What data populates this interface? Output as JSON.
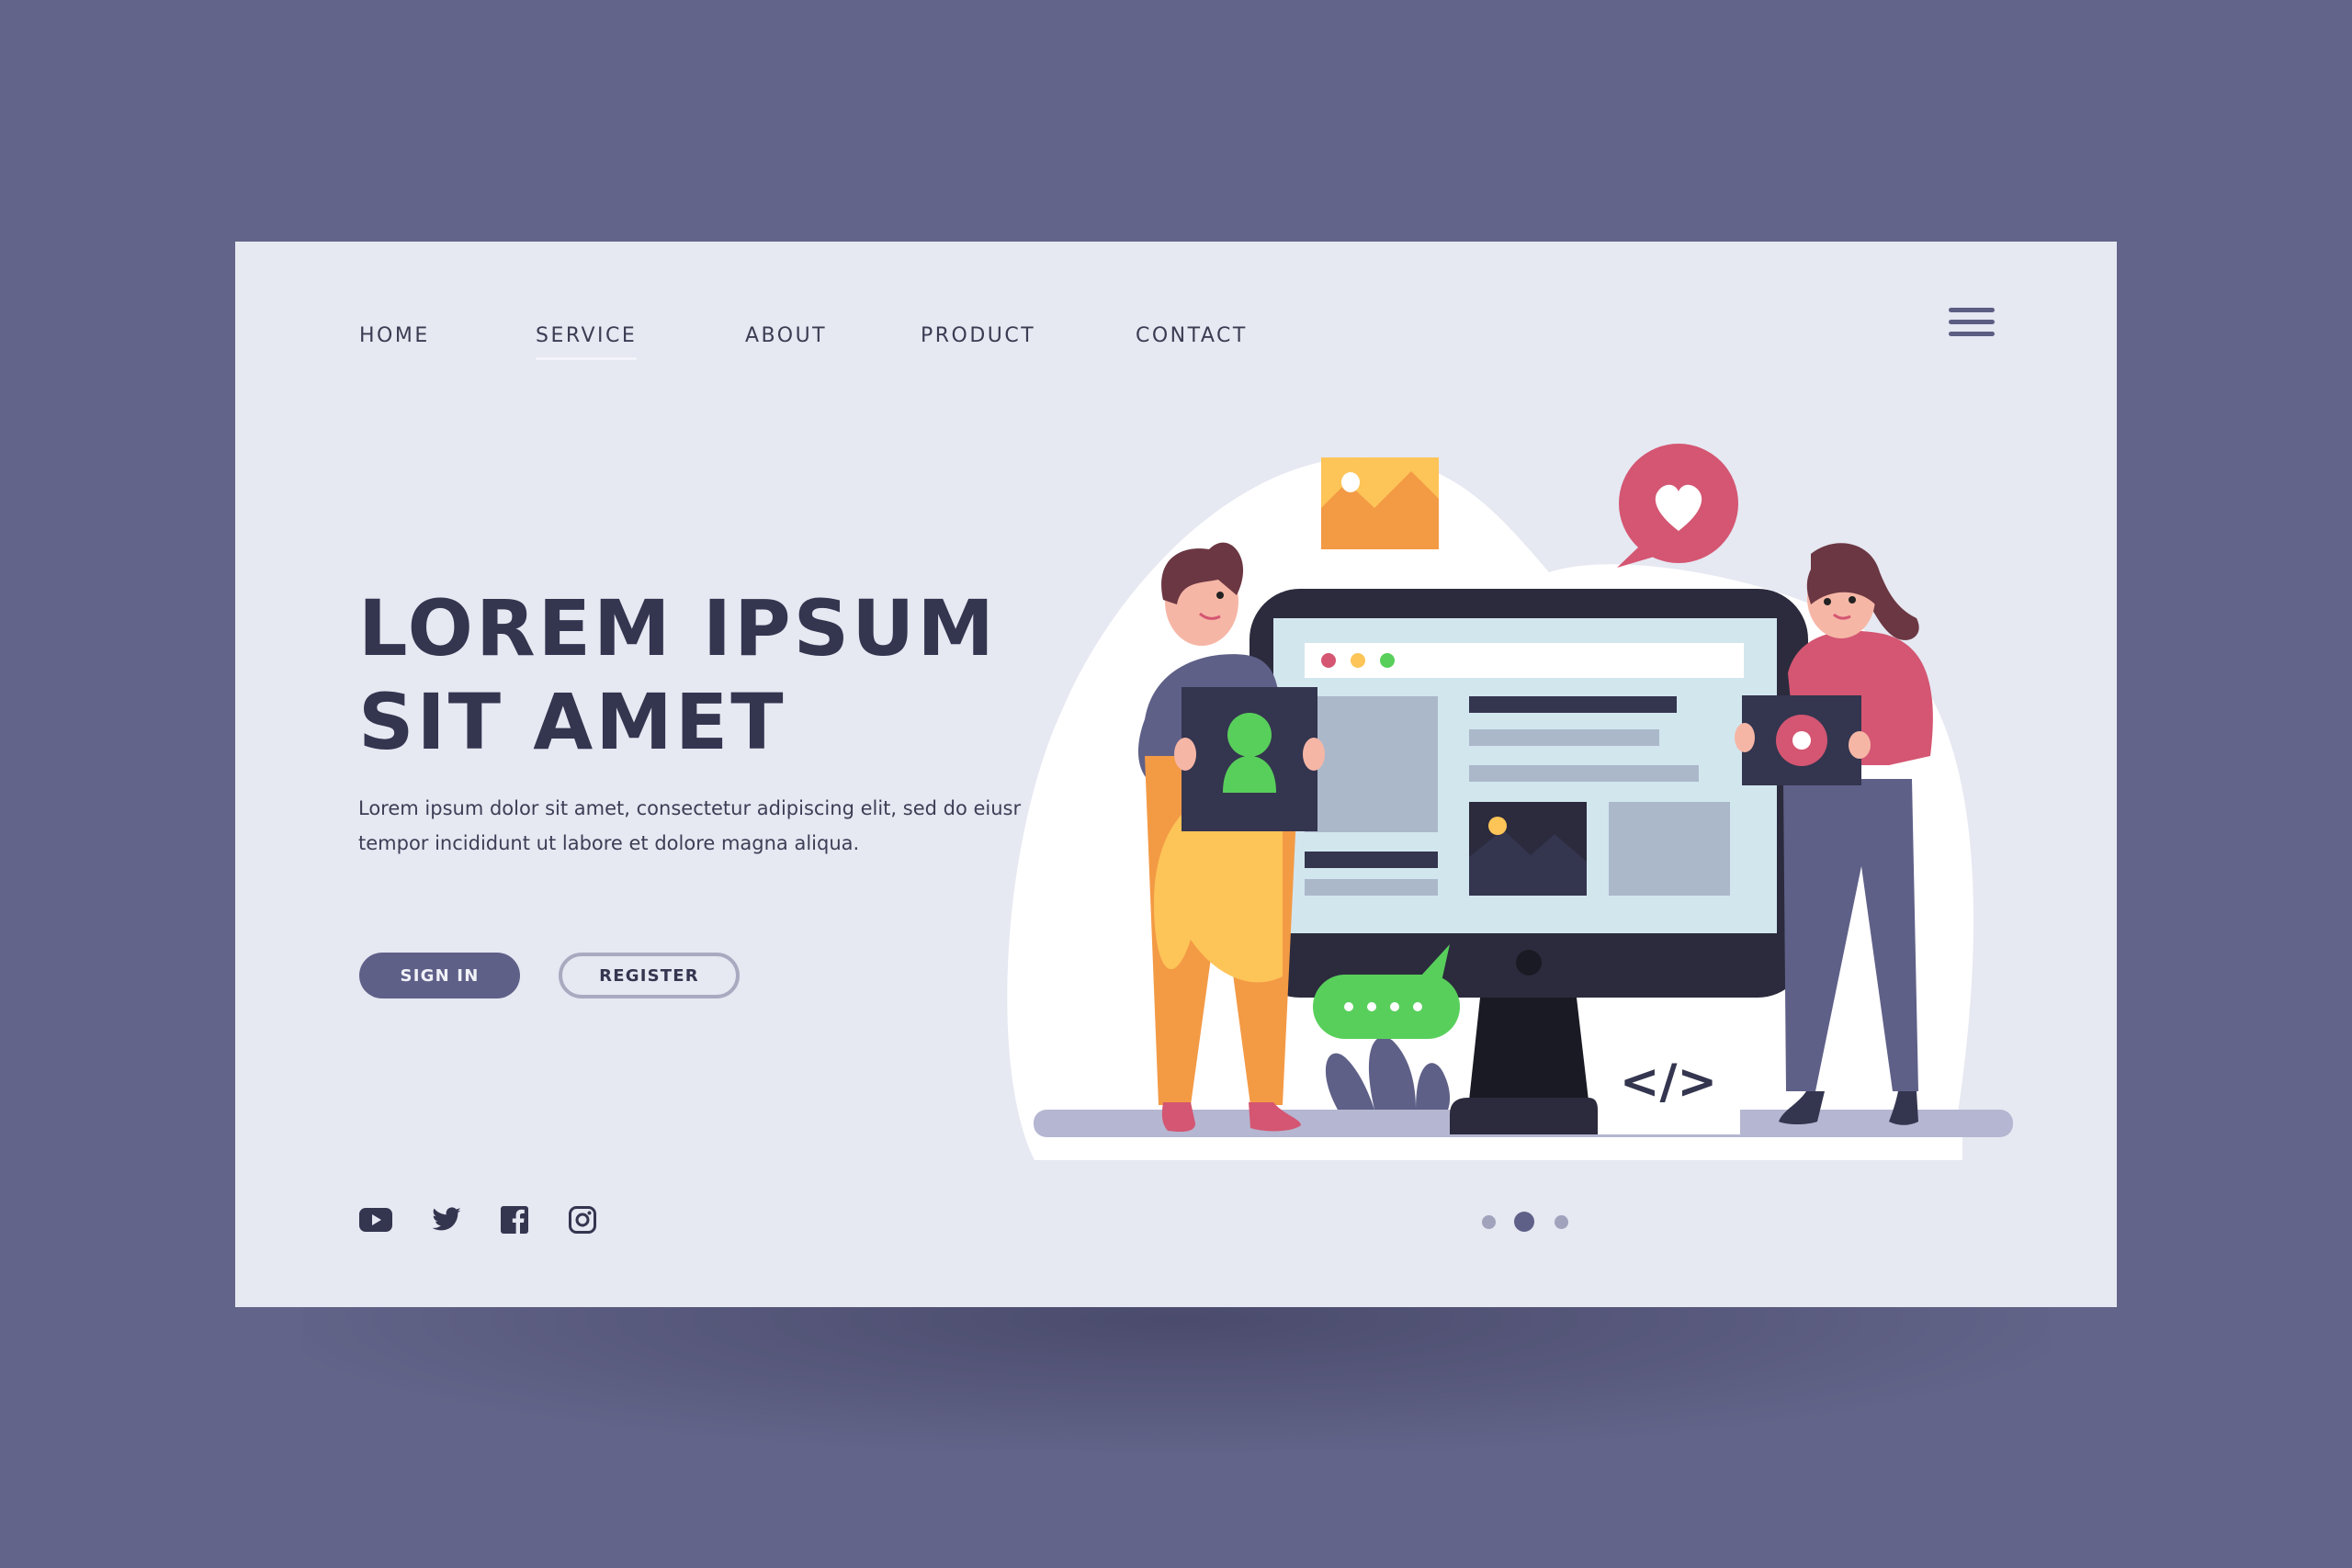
{
  "nav": {
    "items": [
      {
        "label": "HOME",
        "active": false
      },
      {
        "label": "SERVICE",
        "active": true
      },
      {
        "label": "ABOUT",
        "active": false
      },
      {
        "label": "PRODUCT",
        "active": false
      },
      {
        "label": "CONTACT",
        "active": false
      }
    ],
    "menu_icon": "hamburger-menu-icon"
  },
  "hero": {
    "title_line1": "LOREM IPSUM",
    "title_line2": "SIT AMET",
    "text_line1": "Lorem ipsum dolor sit amet, consectetur adipiscing elit, sed do eiusr",
    "text_line2": "tempor incididunt ut labore et dolore magna aliqua."
  },
  "buttons": {
    "signin_label": "SIGN IN",
    "register_label": "REGISTER"
  },
  "social": [
    {
      "name": "youtube-icon"
    },
    {
      "name": "twitter-icon"
    },
    {
      "name": "facebook-icon"
    },
    {
      "name": "instagram-icon"
    }
  ],
  "carousel": {
    "total": 3,
    "active_index": 1
  },
  "illustration": {
    "code_tag": "</>",
    "chat_dots": "• • • •"
  },
  "colors": {
    "page_bg": "#626489",
    "card_bg": "#e6e8f2",
    "heading": "#34354f",
    "accent": "#5f6088",
    "pink": "#d45672",
    "green": "#58cf5b",
    "orange": "#f39a45",
    "yellow": "#fdc457"
  }
}
